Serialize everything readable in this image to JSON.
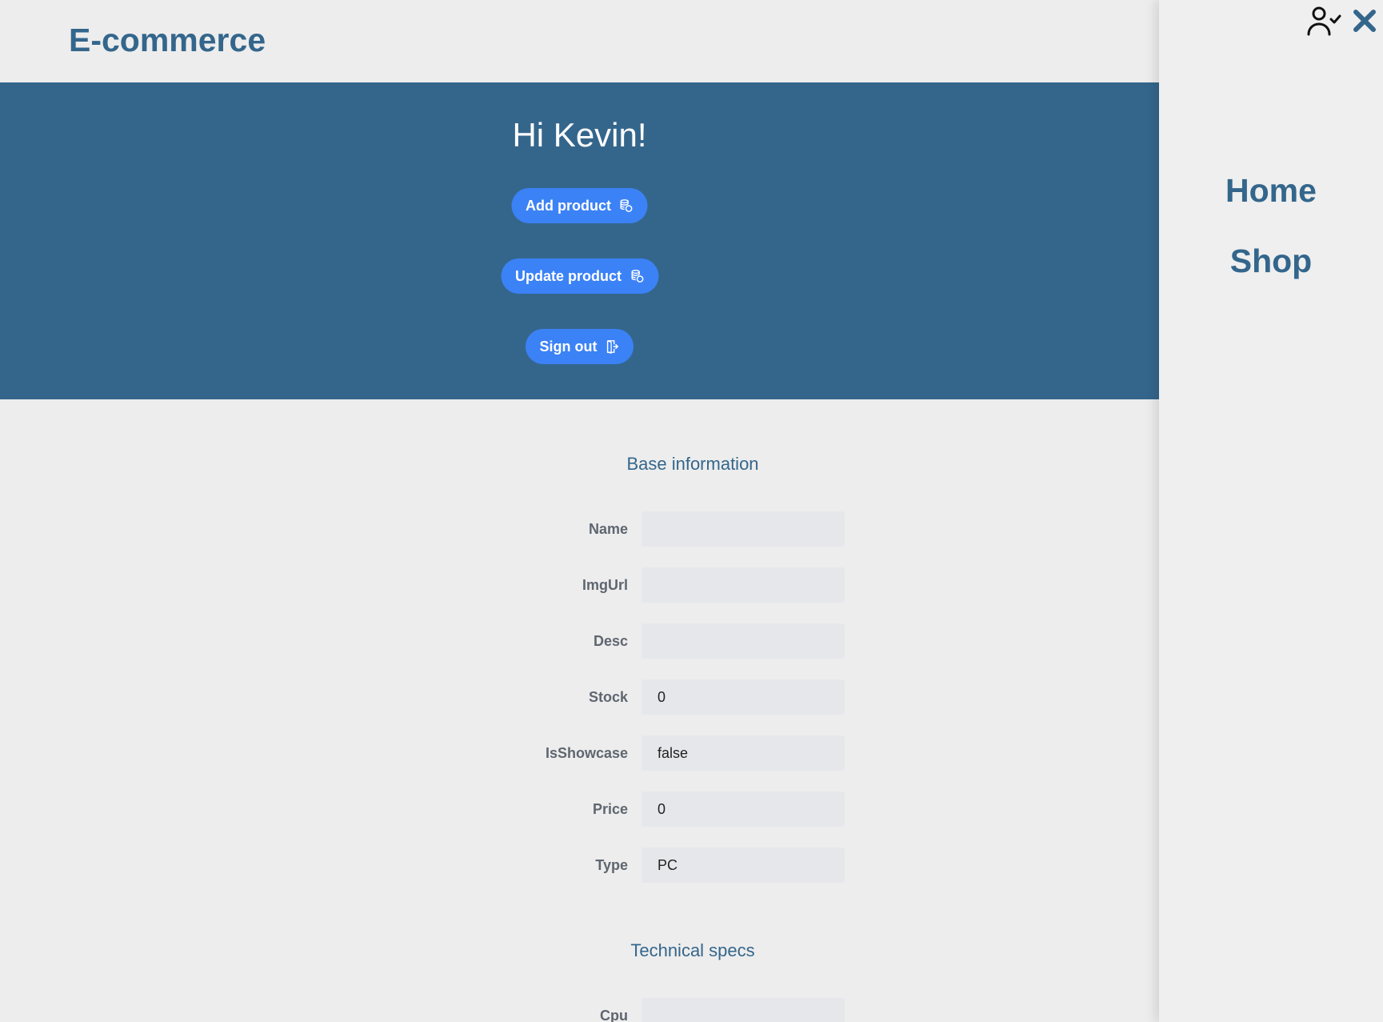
{
  "header": {
    "brand": "E-commerce"
  },
  "hero": {
    "greeting": "Hi Kevin!",
    "add_product_label": "Add product",
    "update_product_label": "Update product",
    "sign_out_label": "Sign out"
  },
  "form": {
    "base_title": "Base information",
    "tech_title": "Technical specs",
    "fields": [
      {
        "label": "Name",
        "value": ""
      },
      {
        "label": "ImgUrl",
        "value": ""
      },
      {
        "label": "Desc",
        "value": ""
      },
      {
        "label": "Stock",
        "value": "0"
      },
      {
        "label": "IsShowcase",
        "value": "false"
      },
      {
        "label": "Price",
        "value": "0"
      },
      {
        "label": "Type",
        "value": "PC"
      }
    ],
    "tech_fields": [
      {
        "label": "Cpu",
        "value": ""
      }
    ]
  },
  "drawer": {
    "nav": [
      {
        "label": "Home"
      },
      {
        "label": "Shop"
      }
    ]
  },
  "colors": {
    "brand": "#34668c",
    "button": "#3b82f6",
    "background": "#ededed",
    "input_bg": "#e6e7ea"
  },
  "icons": {
    "add": "coins-icon",
    "update": "coins-icon",
    "sign_out": "door-exit-icon",
    "user": "user-check-icon",
    "close": "close-icon"
  }
}
